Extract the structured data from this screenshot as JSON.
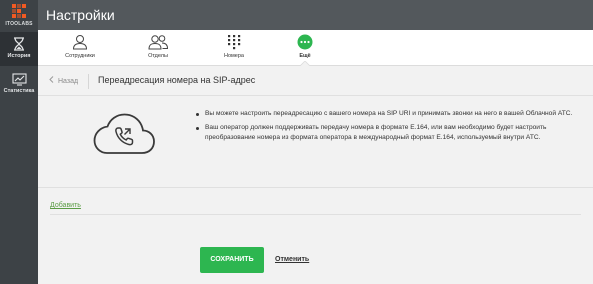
{
  "app": {
    "brand": "ITOOLABS",
    "accent_color": "#f05a23"
  },
  "sidebar": {
    "items": [
      {
        "label": "История",
        "icon": "hourglass-icon"
      },
      {
        "label": "Статистика",
        "icon": "chart-icon"
      }
    ]
  },
  "header": {
    "title": "Настройки"
  },
  "tabs": [
    {
      "label": "Сотрудники",
      "icon": "person-icon"
    },
    {
      "label": "Отделы",
      "icon": "people-icon"
    },
    {
      "label": "Номера",
      "icon": "dialpad-icon"
    },
    {
      "label": "Ещё",
      "icon": "more-icon",
      "active": true
    }
  ],
  "subheader": {
    "back_label": "Назад",
    "title": "Переадресация номера на SIP-адрес"
  },
  "info": {
    "icon": "cloud-phone-icon",
    "bullets": [
      "Вы можете настроить переадресацию с вашего номера на SIP URI и принимать звонки на него в вашей Облачной АТС.",
      "Ваш оператор должен поддерживать передачу номера в формате E.164, или вам необходимо будет настроить преобразование номера из формата оператора в международный формат E.164, используемый внутри АТС."
    ]
  },
  "actions": {
    "add_label": "Добавить",
    "save_label": "СОХРАНИТЬ",
    "cancel_label": "Отменить"
  },
  "colors": {
    "sidebar": "#3d4246",
    "topbar": "#53585c",
    "primary_green": "#2db650",
    "link_green": "#5b9c45"
  }
}
